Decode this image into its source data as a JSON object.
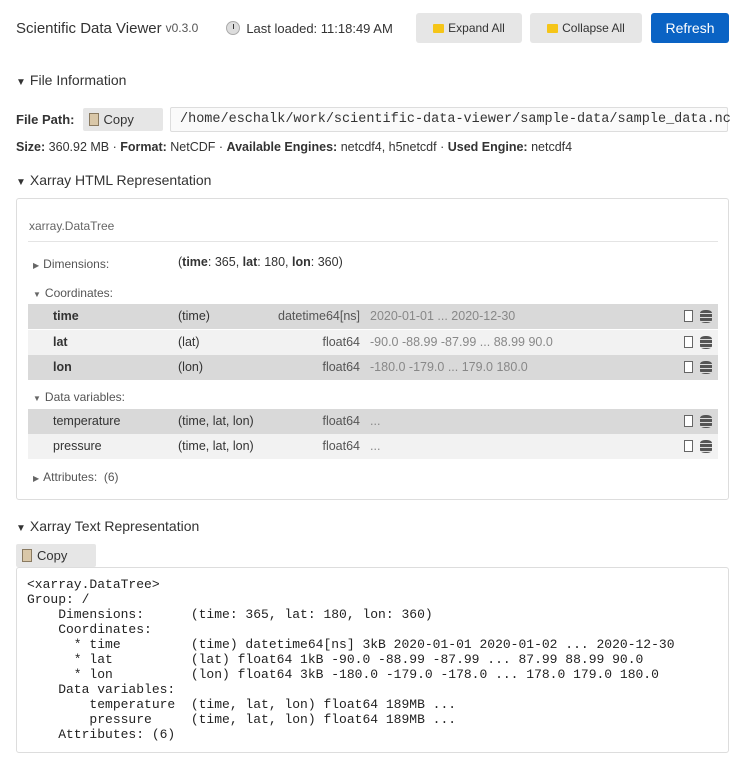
{
  "header": {
    "title": "Scientific Data Viewer",
    "version": "v0.3.0",
    "last_loaded": "Last loaded: 11:18:49 AM",
    "expand_all": "Expand All",
    "collapse_all": "Collapse All",
    "refresh": "Refresh"
  },
  "file_info": {
    "heading": "File Information",
    "path_label": "File Path:",
    "copy": "Copy",
    "path": "/home/eschalk/work/scientific-data-viewer/sample-data/sample_data.nc",
    "size_label": "Size:",
    "size": "360.92 MB",
    "format_label": "Format:",
    "format": "NetCDF",
    "engines_label": "Available Engines:",
    "engines": "netcdf4, h5netcdf",
    "used_label": "Used Engine:",
    "used": "netcdf4"
  },
  "html_rep": {
    "heading": "Xarray HTML Representation",
    "type": "xarray.DataTree",
    "dimensions_label": "Dimensions:",
    "dims": [
      {
        "name": "time",
        "size": "365"
      },
      {
        "name": "lat",
        "size": "180"
      },
      {
        "name": "lon",
        "size": "360"
      }
    ],
    "coordinates_label": "Coordinates:",
    "coordinates": [
      {
        "name": "time",
        "dims": "(time)",
        "dtype": "datetime64[ns]",
        "preview": "2020-01-01 ... 2020-12-30"
      },
      {
        "name": "lat",
        "dims": "(lat)",
        "dtype": "float64",
        "preview": "-90.0 -88.99 -87.99 ... 88.99 90.0"
      },
      {
        "name": "lon",
        "dims": "(lon)",
        "dtype": "float64",
        "preview": "-180.0 -179.0 ... 179.0 180.0"
      }
    ],
    "data_vars_label": "Data variables:",
    "data_vars": [
      {
        "name": "temperature",
        "dims": "(time, lat, lon)",
        "dtype": "float64",
        "preview": "..."
      },
      {
        "name": "pressure",
        "dims": "(time, lat, lon)",
        "dtype": "float64",
        "preview": "..."
      }
    ],
    "attributes_label": "Attributes:",
    "attributes_count": "(6)"
  },
  "text_rep": {
    "heading": "Xarray Text Representation",
    "copy": "Copy",
    "text": "<xarray.DataTree>\nGroup: /\n    Dimensions:      (time: 365, lat: 180, lon: 360)\n    Coordinates:\n      * time         (time) datetime64[ns] 3kB 2020-01-01 2020-01-02 ... 2020-12-30\n      * lat          (lat) float64 1kB -90.0 -88.99 -87.99 ... 87.99 88.99 90.0\n      * lon          (lon) float64 3kB -180.0 -179.0 -178.0 ... 178.0 179.0 180.0\n    Data variables:\n        temperature  (time, lat, lon) float64 189MB ...\n        pressure     (time, lat, lon) float64 189MB ...\n    Attributes: (6)"
  }
}
